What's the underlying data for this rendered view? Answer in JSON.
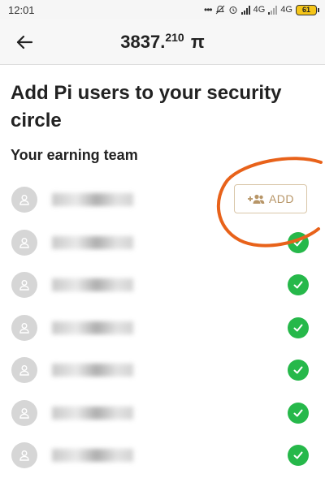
{
  "status_bar": {
    "time": "12:01",
    "net1": "4G",
    "net2": "4G",
    "battery": "61"
  },
  "header": {
    "balance_int": "3837.",
    "balance_dec": "210",
    "currency_symbol": "π"
  },
  "page": {
    "title": "Add Pi users to your security circle",
    "subtitle": "Your earning team"
  },
  "team": {
    "add_label": "ADD",
    "members": [
      {
        "status": "add"
      },
      {
        "status": "added"
      },
      {
        "status": "added"
      },
      {
        "status": "added"
      },
      {
        "status": "added"
      },
      {
        "status": "added"
      },
      {
        "status": "added"
      }
    ]
  },
  "colors": {
    "check_green": "#26b84a",
    "add_accent": "#b79567",
    "annotation_orange": "#e8621a"
  }
}
